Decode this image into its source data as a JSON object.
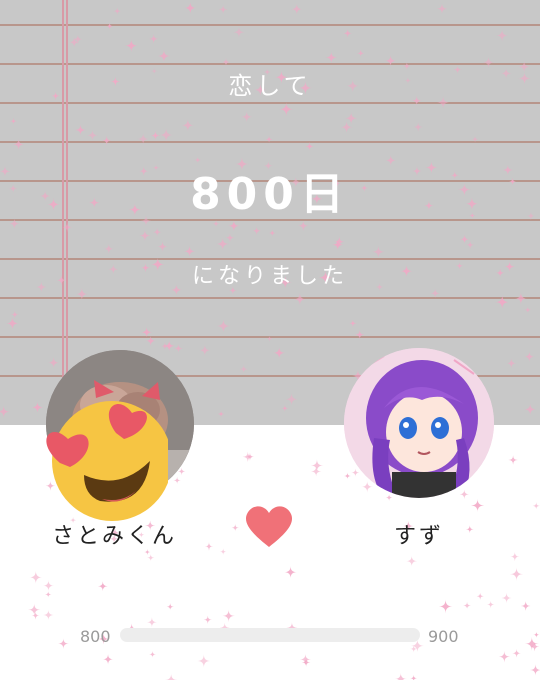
{
  "headline": {
    "line1": "恋して",
    "days": "800日",
    "line3": "になりました"
  },
  "couple": {
    "left": {
      "name": "さとみくん",
      "avatar_icon": "heart-eyes-emoji-icon"
    },
    "right": {
      "name": "すず",
      "avatar_icon": "anime-girl-avatar"
    },
    "center_icon": "heart-icon"
  },
  "progress": {
    "min_label": "800",
    "max_label": "900",
    "fraction": 0.0
  },
  "colors": {
    "paper": "#c8c8c8",
    "rule_line": "#b8968c",
    "margin_line": "#d89aa6",
    "heart": "#f07178",
    "sparkle": "#f2a8c6"
  }
}
